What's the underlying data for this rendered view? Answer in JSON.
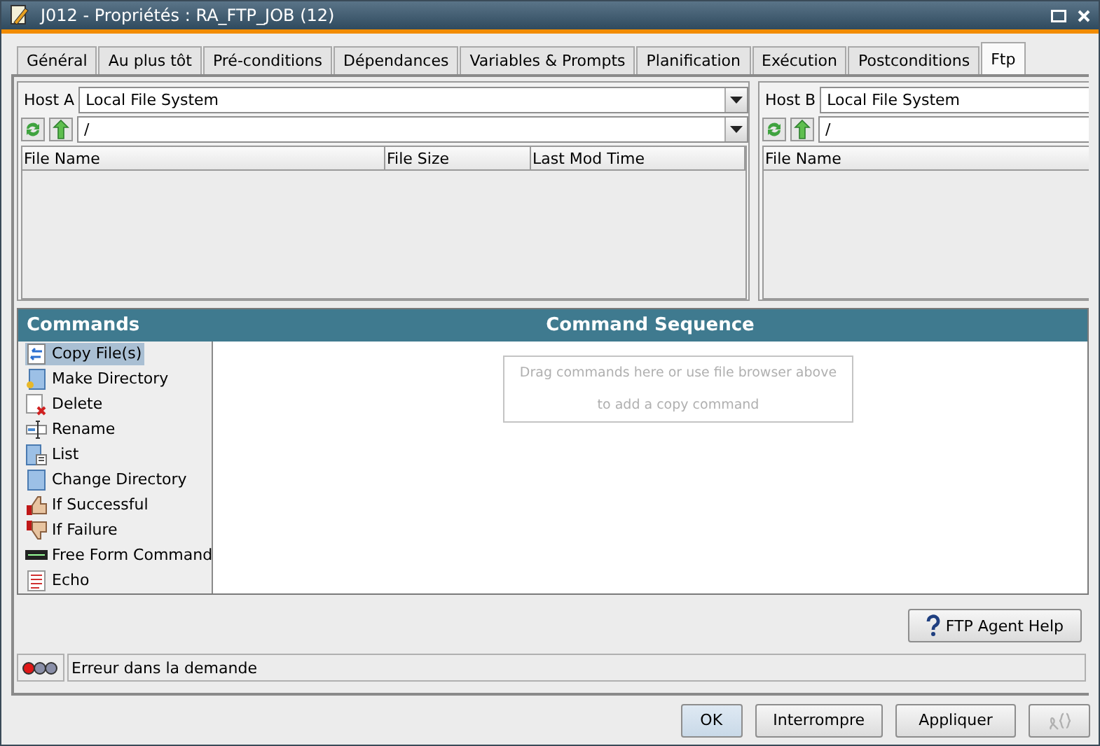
{
  "window": {
    "title": "J012 - Propriétés : RA_FTP_JOB (12)"
  },
  "tabs": [
    {
      "label": "Général",
      "selected": false
    },
    {
      "label": "Au plus tôt",
      "selected": false
    },
    {
      "label": "Pré-conditions",
      "selected": false
    },
    {
      "label": "Dépendances",
      "selected": false
    },
    {
      "label": "Variables & Prompts",
      "selected": false
    },
    {
      "label": "Planification",
      "selected": false
    },
    {
      "label": "Exécution",
      "selected": false
    },
    {
      "label": "Postconditions",
      "selected": false
    },
    {
      "label": "Ftp",
      "selected": true
    }
  ],
  "host_a": {
    "label": "Host A",
    "host": "Local File System",
    "path": "/",
    "columns": [
      "File Name",
      "File Size",
      "Last Mod Time"
    ]
  },
  "host_b": {
    "label": "Host B",
    "host": "Local File System",
    "path": "/",
    "columns": [
      "File Name"
    ]
  },
  "commands": {
    "title": "Commands",
    "items": [
      {
        "label": "Copy File(s)",
        "kind": "copy",
        "selected": true
      },
      {
        "label": "Make Directory",
        "kind": "mkdir",
        "selected": false
      },
      {
        "label": "Delete",
        "kind": "delete",
        "selected": false
      },
      {
        "label": "Rename",
        "kind": "rename",
        "selected": false
      },
      {
        "label": "List",
        "kind": "list",
        "selected": false
      },
      {
        "label": "Change Directory",
        "kind": "chdir",
        "selected": false
      },
      {
        "label": "If Successful",
        "kind": "success",
        "selected": false
      },
      {
        "label": "If Failure",
        "kind": "failure",
        "selected": false
      },
      {
        "label": "Free Form Command",
        "kind": "freeform",
        "selected": false
      },
      {
        "label": "Echo",
        "kind": "echo",
        "selected": false
      }
    ]
  },
  "sequence": {
    "title": "Command Sequence",
    "hint_lines": [
      "Drag commands here or use file browser above",
      "to add a copy command"
    ]
  },
  "help_button": "FTP Agent Help",
  "status": {
    "lights": [
      {
        "color": "#e01818"
      },
      {
        "color": "#8a8fa8"
      },
      {
        "color": "#8a8fa8"
      }
    ],
    "message": "Erreur dans la demande"
  },
  "buttons": [
    {
      "label": "OK",
      "default": true
    },
    {
      "label": "Interrompre",
      "default": false
    },
    {
      "label": "Appliquer",
      "default": false
    }
  ],
  "icon_button": {
    "disabled": true
  }
}
